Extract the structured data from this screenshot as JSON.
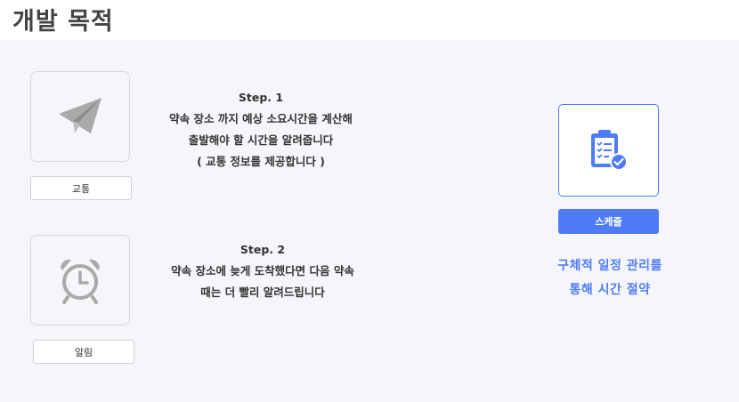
{
  "header": {
    "title": "개발 목적"
  },
  "features": [
    {
      "icon": "paper-plane-icon",
      "label": "교통",
      "step_title": "Step. 1",
      "lines": [
        "약속 장소 까지 예상 소요시간을 계산해",
        "출발해야 할 시간을 알려줍니다",
        "( 교통 정보를 제공합니다 )"
      ]
    },
    {
      "icon": "alarm-clock-icon",
      "label": "알림",
      "step_title": "Step. 2",
      "lines": [
        "약속 장소에 늦게 도착했다면 다음 약속",
        "때는 더 빨리 알려드립니다"
      ]
    }
  ],
  "schedule": {
    "icon": "clipboard-check-icon",
    "button_label": "스케줄",
    "description": [
      "구체적 일정 관리를",
      "통해 시간 절약"
    ]
  },
  "colors": {
    "accent": "#4f7cf6",
    "icon_gray": "#a9a9a9",
    "panel_bg": "#f5f6fa"
  }
}
